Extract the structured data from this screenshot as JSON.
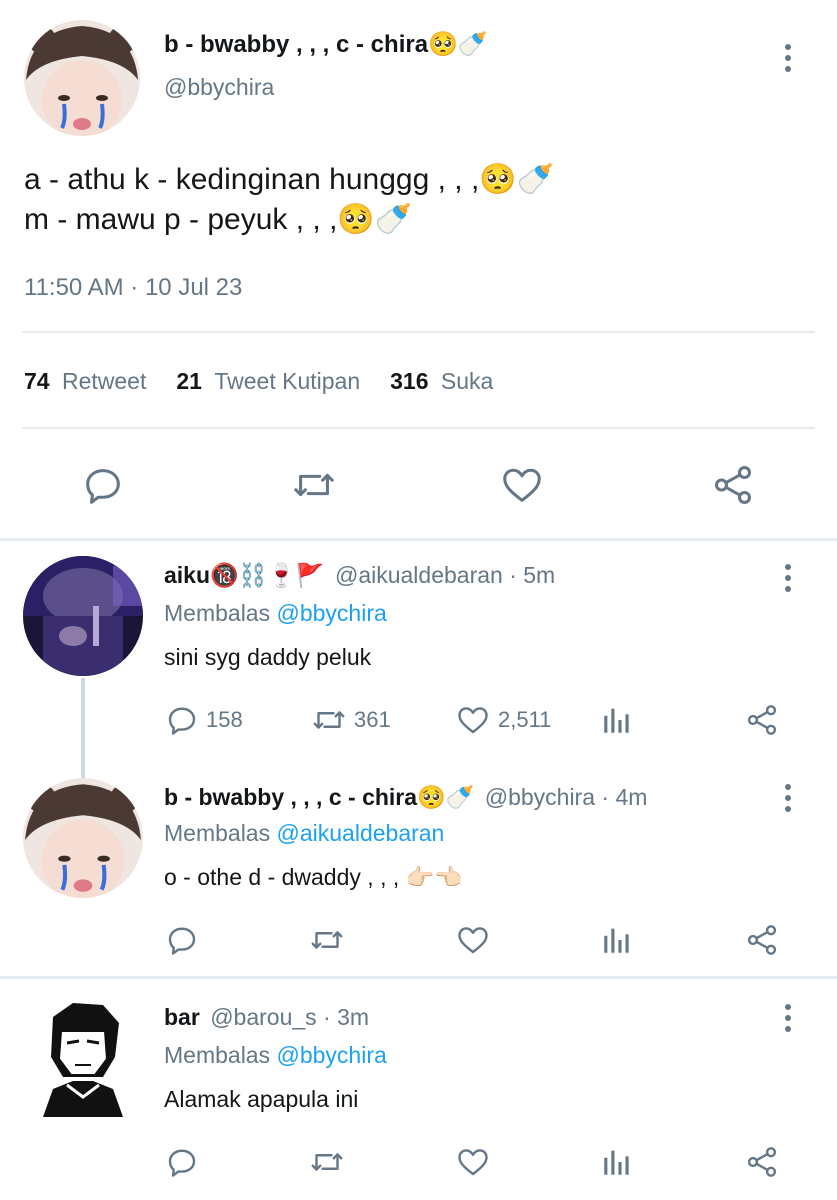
{
  "main_tweet": {
    "display_name": "b - bwabby , , , c - chira🥺🍼",
    "handle": "@bbychira",
    "text_line1": "a - athu k - kedinginan hunggg , , ,🥺🍼",
    "text_line2": "m - mawu p - peyuk , , ,🥺🍼",
    "timestamp": "11:50 AM · 10 Jul 23",
    "stats": {
      "retweets_count": "74",
      "retweets_label": "Retweet",
      "quotes_count": "21",
      "quotes_label": "Tweet Kutipan",
      "likes_count": "316",
      "likes_label": "Suka"
    }
  },
  "replies": [
    {
      "display_name": "aiku🔞⛓️🍷🚩",
      "handle_time": "@aikualdebaran · 5m",
      "replying_label": "Membalas",
      "replying_to": "@bbychira",
      "text": "sini syg daddy peluk",
      "reply_count": "158",
      "retweet_count": "361",
      "like_count": "2,511"
    },
    {
      "display_name": "b - bwabby , , , c - chira🥺🍼",
      "handle_time": "@bbychira · 4m",
      "replying_label": "Membalas",
      "replying_to": "@aikualdebaran",
      "text": "o - othe d - dwaddy , , , 👉🏻👈🏻"
    },
    {
      "display_name": "bar",
      "handle_time": "@barou_s · 3m",
      "replying_label": "Membalas",
      "replying_to": "@bbychira",
      "text": "Alamak apapula ini"
    }
  ],
  "icons": {
    "reply": "comment-bubble-icon",
    "retweet": "retweet-icon",
    "like": "heart-icon",
    "share": "share-icon",
    "views": "bar-chart-icon",
    "more": "more-vertical-icon"
  },
  "colors": {
    "text": "#14171a",
    "secondary": "#657786",
    "link": "#1da1f2",
    "divider": "#e6ecf0",
    "thread_line": "#cfd9de"
  }
}
